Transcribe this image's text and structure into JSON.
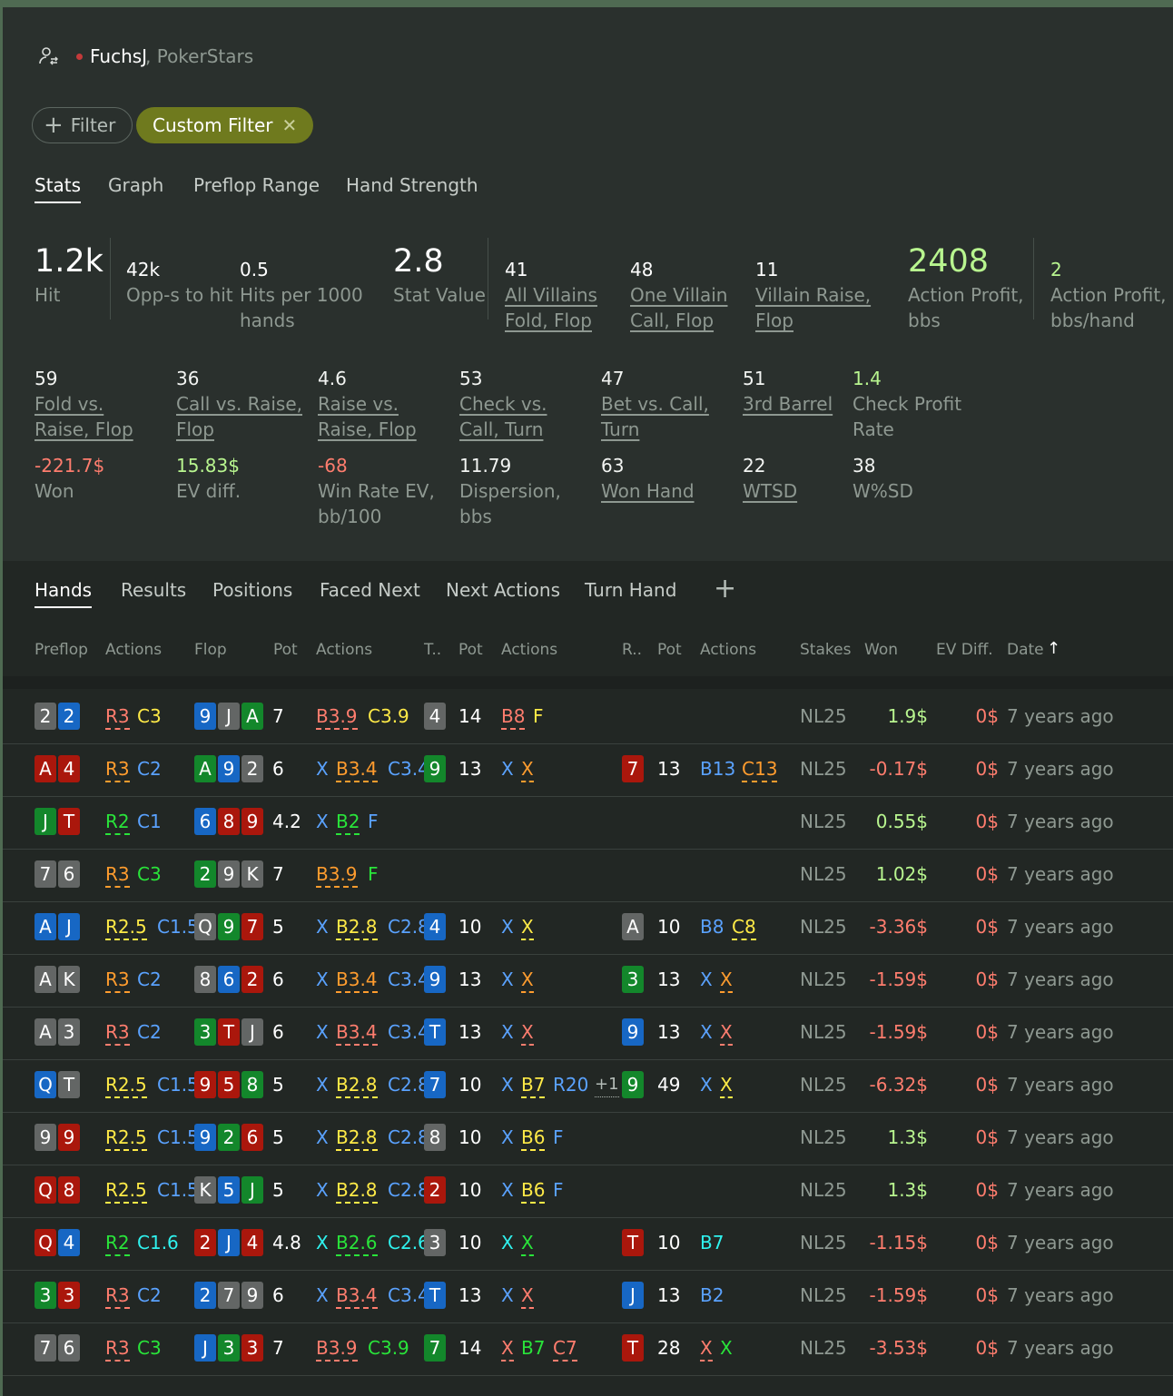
{
  "player": {
    "name": "FuchsJ",
    "site": ", PokerStars"
  },
  "filters": {
    "add_label": "Filter",
    "custom_label": "Custom Filter"
  },
  "stats_tabs": [
    "Stats",
    "Graph",
    "Preflop Range",
    "Hand Strength"
  ],
  "top_stats": {
    "hit": {
      "value": "1.2k",
      "label": "Hit"
    },
    "opps": {
      "value": "42k",
      "label": "Opp-s to hit"
    },
    "hits_per": {
      "value": "0.5",
      "label1": "Hits per 1000",
      "label2": "hands"
    },
    "stat_value": {
      "value": "2.8",
      "label": "Stat Value"
    },
    "all_villains": {
      "value": "41",
      "label1": "All Villains",
      "label2": "Fold, Flop"
    },
    "one_villain": {
      "value": "48",
      "label1": "One Villain",
      "label2": "Call, Flop"
    },
    "villain_raise": {
      "value": "11",
      "label1": "Villain Raise,",
      "label2": "Flop"
    },
    "action_profit": {
      "value": "2408",
      "label1": "Action Profit,",
      "label2": "bbs"
    },
    "action_profit_hand": {
      "value": "2",
      "label1": "Action Profit,",
      "label2": "bbs/hand"
    }
  },
  "grid_stats": [
    {
      "value": "59",
      "l1": "Fold vs.",
      "l2": "Raise, Flop"
    },
    {
      "value": "36",
      "l1": "Call vs. Raise,",
      "l2": "Flop"
    },
    {
      "value": "4.6",
      "l1": "Raise vs.",
      "l2": "Raise, Flop"
    },
    {
      "value": "53",
      "l1": "Check vs.",
      "l2": "Call, Turn"
    },
    {
      "value": "47",
      "l1": "Bet vs. Call,",
      "l2": "Turn"
    },
    {
      "value": "51",
      "l1": "3rd Barrel",
      "l2": ""
    },
    {
      "value": "1.4",
      "l1": "Check Profit",
      "l2": "Rate"
    },
    {
      "value": "-221.7$",
      "l1": "Won",
      "l2": ""
    },
    {
      "value": "15.83$",
      "l1": "EV diff.",
      "l2": ""
    },
    {
      "value": "-68",
      "l1": "Win Rate EV,",
      "l2": "bb/100"
    },
    {
      "value": "11.79",
      "l1": "Dispersion,",
      "l2": "bbs"
    },
    {
      "value": "63",
      "l1": "Won Hand",
      "l2": ""
    },
    {
      "value": "22",
      "l1": "WTSD",
      "l2": ""
    },
    {
      "value": "38",
      "l1": "W%SD",
      "l2": ""
    }
  ],
  "hand_tabs": [
    "Hands",
    "Results",
    "Positions",
    "Faced Next",
    "Next Actions",
    "Turn Hand"
  ],
  "columns": [
    "Preflop",
    "Actions",
    "Flop",
    "Pot",
    "Actions",
    "T..",
    "Pot",
    "Actions",
    "R..",
    "Pot",
    "Actions",
    "Stakes",
    "Won",
    "EV Diff.",
    "Date"
  ],
  "colors": {
    "blue_card": "#1767c4",
    "red_card": "#aa170c",
    "green_card": "#13872b",
    "grey_card": "#636665",
    "positive": "#b8f58f",
    "negative": "#ff7d6e",
    "filter_chip": "#6f7a1e"
  },
  "hands": [
    {
      "pre": [
        [
          "2",
          "k"
        ],
        [
          "2",
          "b"
        ]
      ],
      "pa": [
        [
          "R3",
          "R",
          1
        ],
        [
          "C3",
          "Y",
          0
        ]
      ],
      "flop": [
        [
          "9",
          "b"
        ],
        [
          "J",
          "k"
        ],
        [
          "A",
          "g"
        ]
      ],
      "fpot": "7",
      "fa": [
        [
          "B3.9",
          "R",
          1
        ],
        [
          "C3.9",
          "Y",
          0
        ]
      ],
      "turn": [
        [
          "4",
          "k"
        ]
      ],
      "tpot": "14",
      "ta": [
        [
          "B8",
          "R",
          1
        ],
        [
          "F",
          "Y",
          0
        ]
      ],
      "river": [],
      "rpot": "",
      "ra": [],
      "stakes": "NL25",
      "won": "1.9$",
      "ev": "0$",
      "date": "7 years ago"
    },
    {
      "pre": [
        [
          "A",
          "r"
        ],
        [
          "4",
          "r"
        ]
      ],
      "pa": [
        [
          "R3",
          "O",
          1
        ],
        [
          "C2",
          "B",
          0
        ]
      ],
      "flop": [
        [
          "A",
          "g"
        ],
        [
          "9",
          "b"
        ],
        [
          "2",
          "k"
        ]
      ],
      "fpot": "6",
      "fa": [
        [
          "X",
          "B",
          0
        ],
        [
          "B3.4",
          "O",
          1
        ],
        [
          "C3.4",
          "B",
          0
        ]
      ],
      "turn": [
        [
          "9",
          "g"
        ]
      ],
      "tpot": "13",
      "ta": [
        [
          "X",
          "B",
          0
        ],
        [
          "X",
          "O",
          1
        ]
      ],
      "river": [
        [
          "7",
          "r"
        ]
      ],
      "rpot": "13",
      "ra": [
        [
          "B13",
          "B",
          0
        ],
        [
          "C13",
          "O",
          1
        ]
      ],
      "stakes": "NL25",
      "won": "-0.17$",
      "ev": "0$",
      "date": "7 years ago"
    },
    {
      "pre": [
        [
          "J",
          "g"
        ],
        [
          "T",
          "r"
        ]
      ],
      "pa": [
        [
          "R2",
          "G",
          1
        ],
        [
          "C1",
          "B",
          0
        ]
      ],
      "flop": [
        [
          "6",
          "b"
        ],
        [
          "8",
          "r"
        ],
        [
          "9",
          "r"
        ]
      ],
      "fpot": "4.2",
      "fa": [
        [
          "X",
          "B",
          0
        ],
        [
          "B2",
          "G",
          1
        ],
        [
          "F",
          "B",
          0
        ]
      ],
      "turn": [],
      "tpot": "",
      "ta": [],
      "river": [],
      "rpot": "",
      "ra": [],
      "stakes": "NL25",
      "won": "0.55$",
      "ev": "0$",
      "date": "7 years ago"
    },
    {
      "pre": [
        [
          "7",
          "k"
        ],
        [
          "6",
          "k"
        ]
      ],
      "pa": [
        [
          "R3",
          "O",
          1
        ],
        [
          "C3",
          "G",
          0
        ]
      ],
      "flop": [
        [
          "2",
          "g"
        ],
        [
          "9",
          "k"
        ],
        [
          "K",
          "k"
        ]
      ],
      "fpot": "7",
      "fa": [
        [
          "B3.9",
          "O",
          1
        ],
        [
          "F",
          "G",
          0
        ]
      ],
      "turn": [],
      "tpot": "",
      "ta": [],
      "river": [],
      "rpot": "",
      "ra": [],
      "stakes": "NL25",
      "won": "1.02$",
      "ev": "0$",
      "date": "7 years ago"
    },
    {
      "pre": [
        [
          "A",
          "b"
        ],
        [
          "J",
          "b"
        ]
      ],
      "pa": [
        [
          "R2.5",
          "Y",
          1
        ],
        [
          "C1.5",
          "B",
          0
        ]
      ],
      "flop": [
        [
          "Q",
          "k"
        ],
        [
          "9",
          "g"
        ],
        [
          "7",
          "r"
        ]
      ],
      "fpot": "5",
      "fa": [
        [
          "X",
          "B",
          0
        ],
        [
          "B2.8",
          "Y",
          1
        ],
        [
          "C2.8",
          "B",
          0
        ]
      ],
      "turn": [
        [
          "4",
          "b"
        ]
      ],
      "tpot": "10",
      "ta": [
        [
          "X",
          "B",
          0
        ],
        [
          "X",
          "Y",
          1
        ]
      ],
      "river": [
        [
          "A",
          "k"
        ]
      ],
      "rpot": "10",
      "ra": [
        [
          "B8",
          "B",
          0
        ],
        [
          "C8",
          "Y",
          1
        ]
      ],
      "stakes": "NL25",
      "won": "-3.36$",
      "ev": "0$",
      "date": "7 years ago"
    },
    {
      "pre": [
        [
          "A",
          "k"
        ],
        [
          "K",
          "k"
        ]
      ],
      "pa": [
        [
          "R3",
          "O",
          1
        ],
        [
          "C2",
          "B",
          0
        ]
      ],
      "flop": [
        [
          "8",
          "k"
        ],
        [
          "6",
          "b"
        ],
        [
          "2",
          "r"
        ]
      ],
      "fpot": "6",
      "fa": [
        [
          "X",
          "B",
          0
        ],
        [
          "B3.4",
          "O",
          1
        ],
        [
          "C3.4",
          "B",
          0
        ]
      ],
      "turn": [
        [
          "9",
          "b"
        ]
      ],
      "tpot": "13",
      "ta": [
        [
          "X",
          "B",
          0
        ],
        [
          "X",
          "O",
          1
        ]
      ],
      "river": [
        [
          "3",
          "g"
        ]
      ],
      "rpot": "13",
      "ra": [
        [
          "X",
          "B",
          0
        ],
        [
          "X",
          "O",
          1
        ]
      ],
      "stakes": "NL25",
      "won": "-1.59$",
      "ev": "0$",
      "date": "7 years ago"
    },
    {
      "pre": [
        [
          "A",
          "k"
        ],
        [
          "3",
          "k"
        ]
      ],
      "pa": [
        [
          "R3",
          "R",
          1
        ],
        [
          "C2",
          "B",
          0
        ]
      ],
      "flop": [
        [
          "3",
          "g"
        ],
        [
          "T",
          "r"
        ],
        [
          "J",
          "k"
        ]
      ],
      "fpot": "6",
      "fa": [
        [
          "X",
          "B",
          0
        ],
        [
          "B3.4",
          "R",
          1
        ],
        [
          "C3.4",
          "B",
          0
        ]
      ],
      "turn": [
        [
          "T",
          "b"
        ]
      ],
      "tpot": "13",
      "ta": [
        [
          "X",
          "B",
          0
        ],
        [
          "X",
          "R",
          1
        ]
      ],
      "river": [
        [
          "9",
          "b"
        ]
      ],
      "rpot": "13",
      "ra": [
        [
          "X",
          "B",
          0
        ],
        [
          "X",
          "R",
          1
        ]
      ],
      "stakes": "NL25",
      "won": "-1.59$",
      "ev": "0$",
      "date": "7 years ago"
    },
    {
      "pre": [
        [
          "Q",
          "b"
        ],
        [
          "T",
          "k"
        ]
      ],
      "pa": [
        [
          "R2.5",
          "Y",
          1
        ],
        [
          "C1.5",
          "B",
          0
        ]
      ],
      "flop": [
        [
          "9",
          "r"
        ],
        [
          "5",
          "r"
        ],
        [
          "8",
          "g"
        ]
      ],
      "fpot": "5",
      "fa": [
        [
          "X",
          "B",
          0
        ],
        [
          "B2.8",
          "Y",
          1
        ],
        [
          "C2.8",
          "B",
          0
        ]
      ],
      "turn": [
        [
          "7",
          "b"
        ]
      ],
      "tpot": "10",
      "ta": [
        [
          "X",
          "B",
          0
        ],
        [
          "B7",
          "Y",
          1
        ],
        [
          "R20",
          "B",
          0
        ],
        [
          "+1",
          "W",
          1
        ]
      ],
      "river": [
        [
          "9",
          "g"
        ]
      ],
      "rpot": "49",
      "ra": [
        [
          "X",
          "B",
          0
        ],
        [
          "X",
          "Y",
          1
        ]
      ],
      "stakes": "NL25",
      "won": "-6.32$",
      "ev": "0$",
      "date": "7 years ago"
    },
    {
      "pre": [
        [
          "9",
          "k"
        ],
        [
          "9",
          "r"
        ]
      ],
      "pa": [
        [
          "R2.5",
          "Y",
          1
        ],
        [
          "C1.5",
          "B",
          0
        ]
      ],
      "flop": [
        [
          "9",
          "b"
        ],
        [
          "2",
          "g"
        ],
        [
          "6",
          "r"
        ]
      ],
      "fpot": "5",
      "fa": [
        [
          "X",
          "B",
          0
        ],
        [
          "B2.8",
          "Y",
          1
        ],
        [
          "C2.8",
          "B",
          0
        ]
      ],
      "turn": [
        [
          "8",
          "k"
        ]
      ],
      "tpot": "10",
      "ta": [
        [
          "X",
          "B",
          0
        ],
        [
          "B6",
          "Y",
          1
        ],
        [
          "F",
          "B",
          0
        ]
      ],
      "river": [],
      "rpot": "",
      "ra": [],
      "stakes": "NL25",
      "won": "1.3$",
      "ev": "0$",
      "date": "7 years ago"
    },
    {
      "pre": [
        [
          "Q",
          "r"
        ],
        [
          "8",
          "r"
        ]
      ],
      "pa": [
        [
          "R2.5",
          "Y",
          1
        ],
        [
          "C1.5",
          "B",
          0
        ]
      ],
      "flop": [
        [
          "K",
          "k"
        ],
        [
          "5",
          "b"
        ],
        [
          "J",
          "g"
        ]
      ],
      "fpot": "5",
      "fa": [
        [
          "X",
          "B",
          0
        ],
        [
          "B2.8",
          "Y",
          1
        ],
        [
          "C2.8",
          "B",
          0
        ]
      ],
      "turn": [
        [
          "2",
          "r"
        ]
      ],
      "tpot": "10",
      "ta": [
        [
          "X",
          "B",
          0
        ],
        [
          "B6",
          "Y",
          1
        ],
        [
          "F",
          "B",
          0
        ]
      ],
      "river": [],
      "rpot": "",
      "ra": [],
      "stakes": "NL25",
      "won": "1.3$",
      "ev": "0$",
      "date": "7 years ago"
    },
    {
      "pre": [
        [
          "Q",
          "r"
        ],
        [
          "4",
          "b"
        ]
      ],
      "pa": [
        [
          "R2",
          "G",
          1
        ],
        [
          "C1.6",
          "C",
          0
        ]
      ],
      "flop": [
        [
          "2",
          "r"
        ],
        [
          "J",
          "b"
        ],
        [
          "4",
          "r"
        ]
      ],
      "fpot": "4.8",
      "fa": [
        [
          "X",
          "C",
          0
        ],
        [
          "B2.6",
          "G",
          1
        ],
        [
          "C2.6",
          "C",
          0
        ]
      ],
      "turn": [
        [
          "3",
          "k"
        ]
      ],
      "tpot": "10",
      "ta": [
        [
          "X",
          "C",
          0
        ],
        [
          "X",
          "G",
          1
        ]
      ],
      "river": [
        [
          "T",
          "r"
        ]
      ],
      "rpot": "10",
      "ra": [
        [
          "B7",
          "C",
          0
        ]
      ],
      "stakes": "NL25",
      "won": "-1.15$",
      "ev": "0$",
      "date": "7 years ago"
    },
    {
      "pre": [
        [
          "3",
          "g"
        ],
        [
          "3",
          "r"
        ]
      ],
      "pa": [
        [
          "R3",
          "R",
          1
        ],
        [
          "C2",
          "B",
          0
        ]
      ],
      "flop": [
        [
          "2",
          "b"
        ],
        [
          "7",
          "k"
        ],
        [
          "9",
          "k"
        ]
      ],
      "fpot": "6",
      "fa": [
        [
          "X",
          "B",
          0
        ],
        [
          "B3.4",
          "R",
          1
        ],
        [
          "C3.4",
          "B",
          0
        ]
      ],
      "turn": [
        [
          "T",
          "b"
        ]
      ],
      "tpot": "13",
      "ta": [
        [
          "X",
          "B",
          0
        ],
        [
          "X",
          "R",
          1
        ]
      ],
      "river": [
        [
          "J",
          "b"
        ]
      ],
      "rpot": "13",
      "ra": [
        [
          "B2",
          "B",
          0
        ]
      ],
      "stakes": "NL25",
      "won": "-1.59$",
      "ev": "0$",
      "date": "7 years ago"
    },
    {
      "pre": [
        [
          "7",
          "k"
        ],
        [
          "6",
          "k"
        ]
      ],
      "pa": [
        [
          "R3",
          "R",
          1
        ],
        [
          "C3",
          "G",
          0
        ]
      ],
      "flop": [
        [
          "J",
          "b"
        ],
        [
          "3",
          "g"
        ],
        [
          "3",
          "r"
        ]
      ],
      "fpot": "7",
      "fa": [
        [
          "B3.9",
          "R",
          1
        ],
        [
          "C3.9",
          "G",
          0
        ]
      ],
      "turn": [
        [
          "7",
          "g"
        ]
      ],
      "tpot": "14",
      "ta": [
        [
          "X",
          "R",
          1
        ],
        [
          "B7",
          "G",
          0
        ],
        [
          "C7",
          "R",
          1
        ]
      ],
      "river": [
        [
          "T",
          "r"
        ]
      ],
      "rpot": "28",
      "ra": [
        [
          "X",
          "R",
          1
        ],
        [
          "X",
          "G",
          0
        ]
      ],
      "stakes": "NL25",
      "won": "-3.53$",
      "ev": "0$",
      "date": "7 years ago"
    }
  ]
}
